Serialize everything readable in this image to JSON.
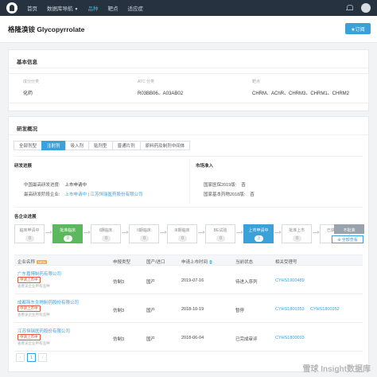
{
  "nav": {
    "items": [
      "首页",
      "数据库导航",
      "品种",
      "靶点",
      "适应症"
    ],
    "active_index": 2,
    "database_caret": "▼"
  },
  "header": {
    "title": "格隆溴铵 Glycopyrrolate",
    "subscribe_label": "★订阅"
  },
  "basic_info": {
    "section_title": "基本信息",
    "cols": [
      {
        "label": "成分分类",
        "value": "化药"
      },
      {
        "label": "ATC 分类",
        "value": "R03BB06、A03AB02"
      },
      {
        "label": "靶点",
        "value": "CHRM、AChR、CHRM3、CHRM1、CHRM2"
      }
    ]
  },
  "dev_overview": {
    "section_title": "研发概况",
    "tabs": [
      "全部剂型",
      "注射剂",
      "吸入剂",
      "贴剂型",
      "普通片剂",
      "原料药及制剂中间体"
    ],
    "active_tab": 1,
    "progress_title": "研发进展",
    "progress_rows": [
      {
        "label": "中国最高研发进度:",
        "value": "上市申请中",
        "is_link": false
      },
      {
        "label": "最高研发阶段企业:",
        "value": "上市申请中 | 江苏恒瑞医药股份有限公司",
        "is_link": true
      }
    ],
    "market_title": "市场准入",
    "market_rows": [
      {
        "label": "国家医保2019版:",
        "value": "否"
      },
      {
        "label": "国家基本药物2018版:",
        "value": "否"
      }
    ]
  },
  "pipeline": {
    "title": "各企业进展",
    "stages": [
      {
        "name": "临床申请中",
        "count": "0",
        "state": "normal"
      },
      {
        "name": "批准临床",
        "count": "8",
        "state": "green"
      },
      {
        "name": "I期临床",
        "count": "0",
        "state": "normal"
      },
      {
        "name": "II期临床",
        "count": "0",
        "state": "normal"
      },
      {
        "name": "III期临床",
        "count": "0",
        "state": "normal"
      },
      {
        "name": "BE试验",
        "count": "0",
        "state": "normal"
      },
      {
        "name": "上市申请中",
        "count": "3",
        "state": "blue"
      },
      {
        "name": "批准上市",
        "count": "0",
        "state": "normal"
      },
      {
        "name": "已获文号",
        "count": "0",
        "state": "normal"
      },
      {
        "name": "不批准",
        "count": "1",
        "state": "gray"
      }
    ],
    "view_all_label": "⊕ 全部查看"
  },
  "table": {
    "headers": [
      "企业名称",
      "申报类型",
      "国产/进口",
      "申请上市时间",
      "当前状态",
      "相关受理号"
    ],
    "new_badge": "NEW",
    "rows": [
      {
        "company": "广东嘉博制药有限公司",
        "tag": "申请上市中",
        "sub": "查看该企业所有品种",
        "type": "仿制3",
        "origin": "国产",
        "date": "2019-07-16",
        "status": "待进入序列",
        "accepts": [
          "CYHS1900489"
        ]
      },
      {
        "company": "成都苑东生物制药股份有限公司",
        "tag": "申请上市中",
        "sub": "查看该企业所有品种",
        "type": "仿制3",
        "origin": "国产",
        "date": "2018-10-19",
        "status": "暂停",
        "accepts": [
          "CYHS1800353",
          "CYHS1800352"
        ]
      },
      {
        "company": "江苏恒瑞医药股份有限公司",
        "tag": "申请上市中",
        "sub": "查看该企业所有品种",
        "type": "仿制3",
        "origin": "国产",
        "date": "2018-06-04",
        "status": "已完成审评",
        "accepts": [
          "CYHS1800093"
        ]
      }
    ]
  },
  "pagination": {
    "prev": "‹",
    "page": "1",
    "next": "›"
  },
  "watermark": "雪球 Insight数据库",
  "colors": {
    "accent": "#3ba1d9",
    "green": "#5cb85c",
    "nav_bg": "#26323f"
  }
}
